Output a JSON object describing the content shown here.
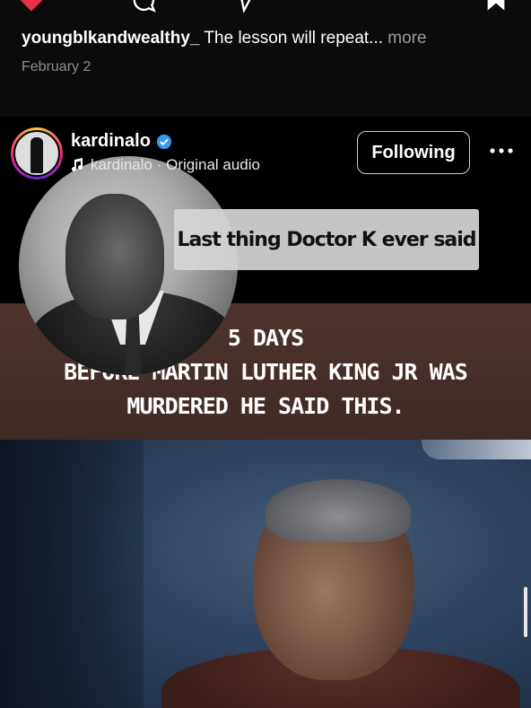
{
  "post": {
    "username": "youngblkandwealthy_",
    "caption": " The lesson will repeat...",
    "more_label": " more",
    "date": "February 2"
  },
  "reel": {
    "username": "kardinalo",
    "audio_label": "kardinalo · Original audio",
    "follow_label": "Following",
    "overlay_caption": "Last thing Doctor K ever said",
    "headline_line1": "5 DAYS",
    "headline_line2": "BEFORE MARTIN LUTHER KING JR WAS",
    "headline_line3": "MURDERED HE SAID THIS."
  },
  "icons": [
    "heart-icon",
    "comment-icon",
    "share-icon",
    "bookmark-icon",
    "verified-icon",
    "music-note-icon",
    "more-icon"
  ],
  "colors": {
    "background": "#0b0b0c",
    "heart": "#ed2f44",
    "band": "#4d332e",
    "muted_text": "#8e8e8e"
  }
}
